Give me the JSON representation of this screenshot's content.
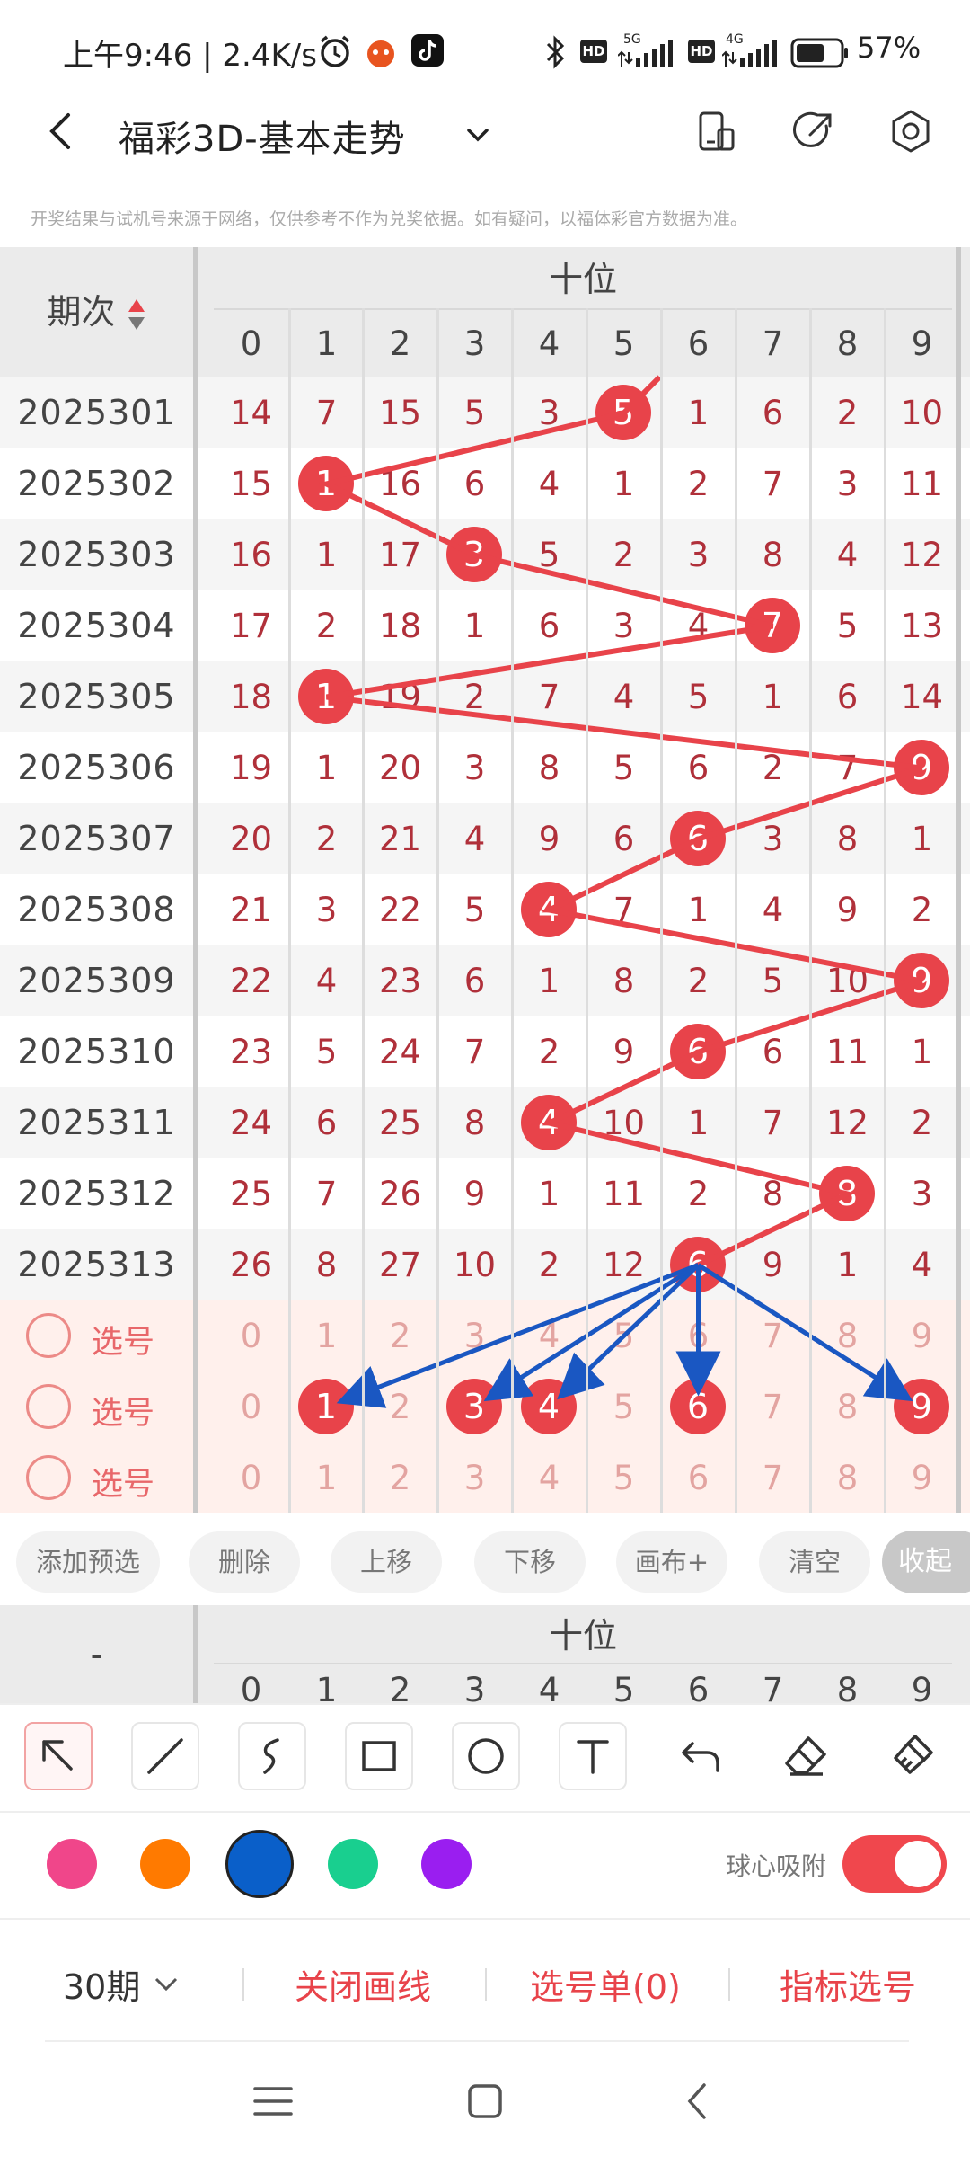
{
  "status_bar": {
    "time_speed": "上午9:46 | 2.4K/s",
    "network_5g": "5G",
    "network_4g": "4G",
    "hd1": "HD",
    "hd2": "HD",
    "battery": "57%"
  },
  "header": {
    "title": "福彩3D-基本走势",
    "disclaimer": "开奖结果与试机号来源于网络，仅供参考不作为兑奖依据。如有疑问，以福体彩官方数据为准。"
  },
  "table": {
    "period_header": "期次",
    "group_header": "十位",
    "digit_headers": [
      "0",
      "1",
      "2",
      "3",
      "4",
      "5",
      "6",
      "7",
      "8",
      "9"
    ],
    "rows": [
      {
        "period": "2025301",
        "cells": [
          "14",
          "7",
          "15",
          "5",
          "3",
          "5",
          "1",
          "6",
          "2",
          "10"
        ],
        "hit": 5
      },
      {
        "period": "2025302",
        "cells": [
          "15",
          "1",
          "16",
          "6",
          "4",
          "1",
          "2",
          "7",
          "3",
          "11"
        ],
        "hit": 1
      },
      {
        "period": "2025303",
        "cells": [
          "16",
          "1",
          "17",
          "3",
          "5",
          "2",
          "3",
          "8",
          "4",
          "12"
        ],
        "hit": 3
      },
      {
        "period": "2025304",
        "cells": [
          "17",
          "2",
          "18",
          "1",
          "6",
          "3",
          "4",
          "7",
          "5",
          "13"
        ],
        "hit": 7
      },
      {
        "period": "2025305",
        "cells": [
          "18",
          "1",
          "19",
          "2",
          "7",
          "4",
          "5",
          "1",
          "6",
          "14"
        ],
        "hit": 1
      },
      {
        "period": "2025306",
        "cells": [
          "19",
          "1",
          "20",
          "3",
          "8",
          "5",
          "6",
          "2",
          "7",
          "9"
        ],
        "hit": 9
      },
      {
        "period": "2025307",
        "cells": [
          "20",
          "2",
          "21",
          "4",
          "9",
          "6",
          "6",
          "3",
          "8",
          "1"
        ],
        "hit": 6
      },
      {
        "period": "2025308",
        "cells": [
          "21",
          "3",
          "22",
          "5",
          "4",
          "7",
          "1",
          "4",
          "9",
          "2"
        ],
        "hit": 4
      },
      {
        "period": "2025309",
        "cells": [
          "22",
          "4",
          "23",
          "6",
          "1",
          "8",
          "2",
          "5",
          "10",
          "9"
        ],
        "hit": 9
      },
      {
        "period": "2025310",
        "cells": [
          "23",
          "5",
          "24",
          "7",
          "2",
          "9",
          "6",
          "6",
          "11",
          "1"
        ],
        "hit": 6
      },
      {
        "period": "2025311",
        "cells": [
          "24",
          "6",
          "25",
          "8",
          "4",
          "10",
          "1",
          "7",
          "12",
          "2"
        ],
        "hit": 4
      },
      {
        "period": "2025312",
        "cells": [
          "25",
          "7",
          "26",
          "9",
          "1",
          "11",
          "2",
          "8",
          "8",
          "3"
        ],
        "hit": 8
      },
      {
        "period": "2025313",
        "cells": [
          "26",
          "8",
          "27",
          "10",
          "2",
          "12",
          "6",
          "9",
          "1",
          "4"
        ],
        "hit": 6
      }
    ],
    "select_rows": [
      {
        "label": "选号",
        "cells": [
          "0",
          "1",
          "2",
          "3",
          "4",
          "5",
          "6",
          "7",
          "8",
          "9"
        ],
        "selected": []
      },
      {
        "label": "选号",
        "cells": [
          "0",
          "1",
          "2",
          "3",
          "4",
          "5",
          "6",
          "7",
          "8",
          "9"
        ],
        "selected": [
          1,
          3,
          4,
          6,
          9
        ]
      },
      {
        "label": "选号",
        "cells": [
          "0",
          "1",
          "2",
          "3",
          "4",
          "5",
          "6",
          "7",
          "8",
          "9"
        ],
        "selected": []
      }
    ]
  },
  "toolbar": {
    "buttons": [
      "添加预选",
      "删除",
      "上移",
      "下移",
      "画布+",
      "清空"
    ],
    "collapse": "收起"
  },
  "lower_header": {
    "period_placeholder": "-",
    "group_header": "十位",
    "digit_headers": [
      "0",
      "1",
      "2",
      "3",
      "4",
      "5",
      "6",
      "7",
      "8",
      "9"
    ]
  },
  "drawing_tools": [
    "pointer-icon",
    "line-icon",
    "curve-icon",
    "rectangle-icon",
    "circle-icon",
    "text-icon",
    "undo-icon",
    "eraser-icon",
    "clear-brush-icon"
  ],
  "colors": [
    "#f0468a",
    "#ff7a00",
    "#0a5fc9",
    "#19cf8f",
    "#9a1ef0"
  ],
  "selected_color": "#0a5fc9",
  "snap": {
    "label": "球心吸附",
    "on": true
  },
  "bottom_bar": {
    "periods": "30期",
    "close_lines": "关闭画线",
    "pick_list": "选号单(0)",
    "indicator_pick": "指标选号"
  },
  "accent": "#e8434a"
}
